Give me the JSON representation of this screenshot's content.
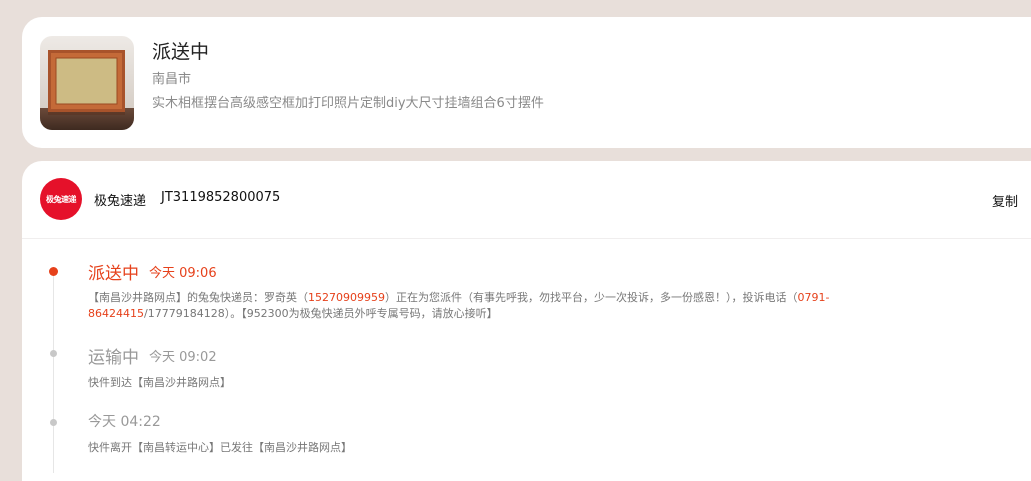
{
  "product": {
    "status": "派送中",
    "city": "南昌市",
    "name": "实木相框摆台高级感空框加打印照片定制diy大尺寸挂墙组合6寸摆件"
  },
  "courier": {
    "logo_text": "极兔速递",
    "name": "极兔速递",
    "tracking_number": "JT3119852800075",
    "copy_label": "复制",
    "brand_color": "#e5112a"
  },
  "timeline": [
    {
      "status": "派送中",
      "time": "今天 09:06",
      "desc_parts": [
        "【南昌沙井路网点】的兔兔快递员：罗奇英（",
        "15270909959",
        "）正在为您派件（有事先呼我，勿找平台，少一次投诉，多一份感恩！），投诉电话（",
        "0791-",
        "86424415",
        "/17779184128）。【952300为极兔快递员外呼专属号码，请放心接听】"
      ]
    },
    {
      "status": "运输中",
      "time": "今天 09:02",
      "desc": "快件到达【南昌沙井路网点】"
    },
    {
      "status": "",
      "time": "今天 04:22",
      "desc": "快件离开【南昌转运中心】已发往【南昌沙井路网点】"
    }
  ],
  "colors": {
    "accent": "#e6411b",
    "background": "#e8dfda"
  },
  "icons": {
    "product_thumbnail": "wooden-photo-frame-image"
  }
}
